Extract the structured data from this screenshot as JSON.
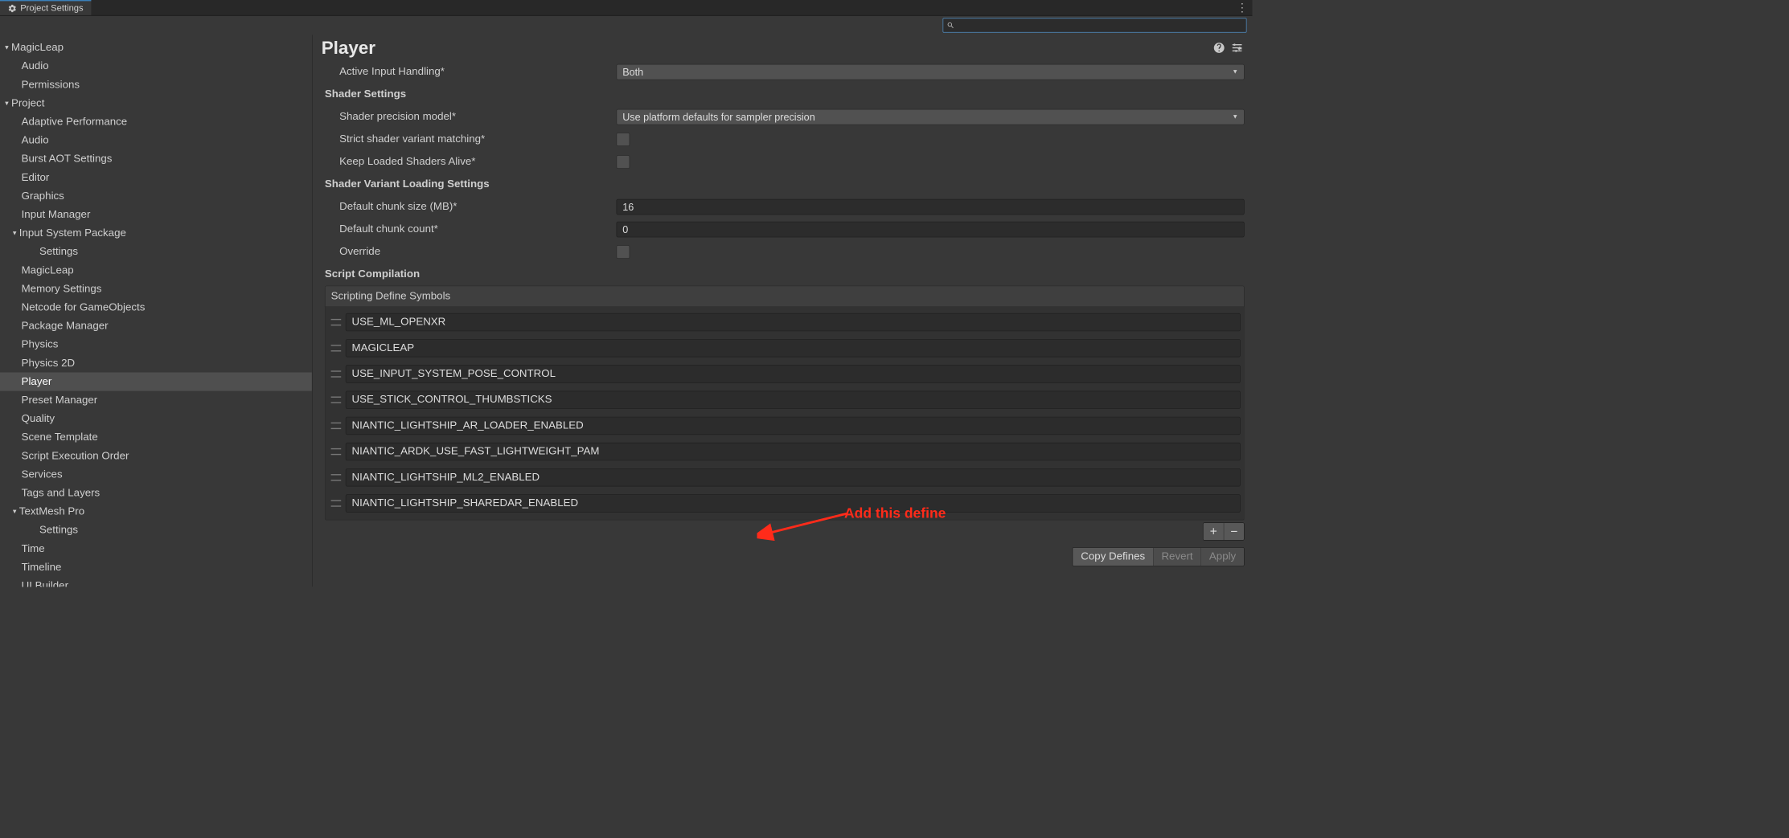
{
  "tab": {
    "title": "Project Settings"
  },
  "search": {
    "value": ""
  },
  "sidebar": [
    {
      "label": "MagicLeap",
      "depth": 0,
      "expandable": true,
      "expanded": true
    },
    {
      "label": "Audio",
      "depth": 1
    },
    {
      "label": "Permissions",
      "depth": 1
    },
    {
      "label": "Project",
      "depth": 0,
      "expandable": true,
      "expanded": true
    },
    {
      "label": "Adaptive Performance",
      "depth": 1
    },
    {
      "label": "Audio",
      "depth": 1
    },
    {
      "label": "Burst AOT Settings",
      "depth": 1
    },
    {
      "label": "Editor",
      "depth": 1
    },
    {
      "label": "Graphics",
      "depth": 1
    },
    {
      "label": "Input Manager",
      "depth": 1
    },
    {
      "label": "Input System Package",
      "depth": 1,
      "expandable": true,
      "expanded": true,
      "hdr": true
    },
    {
      "label": "Settings",
      "depth": 2
    },
    {
      "label": "MagicLeap",
      "depth": 1
    },
    {
      "label": "Memory Settings",
      "depth": 1
    },
    {
      "label": "Netcode for GameObjects",
      "depth": 1
    },
    {
      "label": "Package Manager",
      "depth": 1
    },
    {
      "label": "Physics",
      "depth": 1
    },
    {
      "label": "Physics 2D",
      "depth": 1
    },
    {
      "label": "Player",
      "depth": 1,
      "selected": true
    },
    {
      "label": "Preset Manager",
      "depth": 1
    },
    {
      "label": "Quality",
      "depth": 1
    },
    {
      "label": "Scene Template",
      "depth": 1
    },
    {
      "label": "Script Execution Order",
      "depth": 1
    },
    {
      "label": "Services",
      "depth": 1
    },
    {
      "label": "Tags and Layers",
      "depth": 1
    },
    {
      "label": "TextMesh Pro",
      "depth": 1,
      "expandable": true,
      "expanded": true,
      "hdr": true
    },
    {
      "label": "Settings",
      "depth": 2
    },
    {
      "label": "Time",
      "depth": 1
    },
    {
      "label": "Timeline",
      "depth": 1
    },
    {
      "label": "UI Builder",
      "depth": 1
    }
  ],
  "header": {
    "title": "Player"
  },
  "fields": {
    "active_input_handling": {
      "label": "Active Input Handling*",
      "value": "Both"
    },
    "shader_settings_hdr": "Shader Settings",
    "shader_precision": {
      "label": "Shader precision model*",
      "value": "Use platform defaults for sampler precision"
    },
    "strict_variant": {
      "label": "Strict shader variant matching*"
    },
    "keep_loaded": {
      "label": "Keep Loaded Shaders Alive*"
    },
    "shader_variant_hdr": "Shader Variant Loading Settings",
    "chunk_size": {
      "label": "Default chunk size (MB)*",
      "value": "16"
    },
    "chunk_count": {
      "label": "Default chunk count*",
      "value": "0"
    },
    "override": {
      "label": "Override"
    },
    "script_comp_hdr": "Script Compilation",
    "scripting_symbols_label": "Scripting Define Symbols"
  },
  "symbols": [
    "USE_ML_OPENXR",
    "MAGICLEAP",
    "USE_INPUT_SYSTEM_POSE_CONTROL",
    "USE_STICK_CONTROL_THUMBSTICKS",
    "NIANTIC_LIGHTSHIP_AR_LOADER_ENABLED",
    "NIANTIC_ARDK_USE_FAST_LIGHTWEIGHT_PAM",
    "NIANTIC_LIGHTSHIP_ML2_ENABLED",
    "NIANTIC_LIGHTSHIP_SHAREDAR_ENABLED"
  ],
  "annotation": {
    "text": "Add this define"
  },
  "buttons": {
    "copy": "Copy Defines",
    "revert": "Revert",
    "apply": "Apply"
  }
}
